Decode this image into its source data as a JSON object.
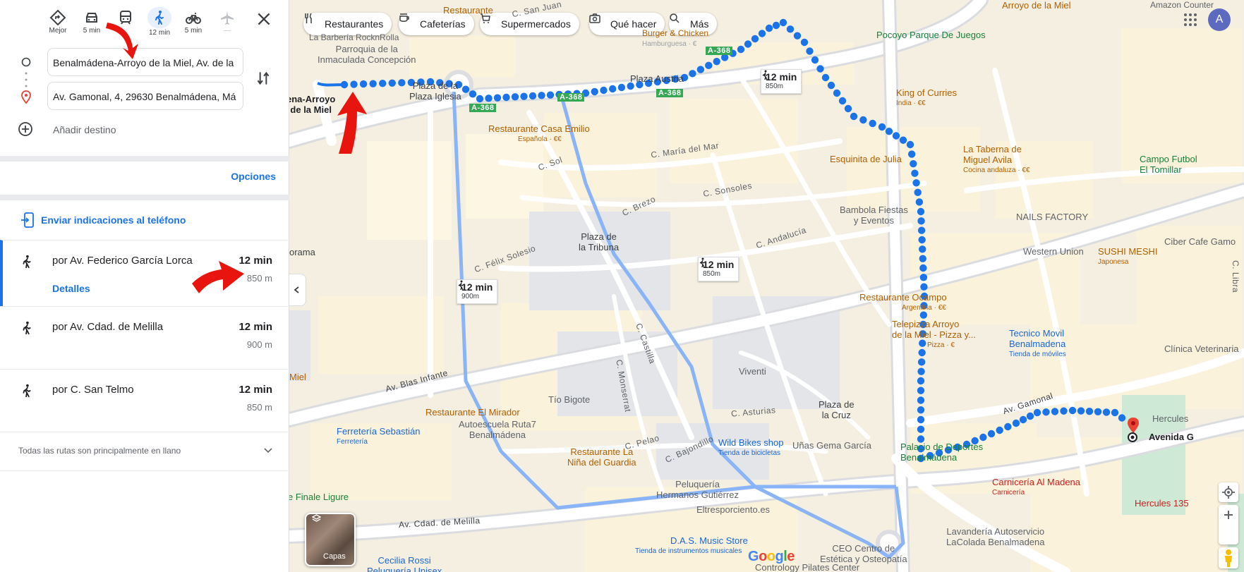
{
  "modes": [
    {
      "label": "Mejor",
      "icon": "diamond-directions-icon"
    },
    {
      "label": "5 min",
      "icon": "car-icon"
    },
    {
      "label": "",
      "icon": "transit-icon"
    },
    {
      "label": "12 min",
      "icon": "walking-icon",
      "active": true
    },
    {
      "label": "5 min",
      "icon": "bicycle-icon"
    },
    {
      "label": "—",
      "icon": "airplane-icon"
    }
  ],
  "origin": "Benalmádena-Arroyo de la Miel, Av. de la",
  "destination": "Av. Gamonal, 4, 29630 Benalmádena, Má",
  "add_destination": "Añadir destino",
  "options": "Opciones",
  "send_to_phone": "Enviar indicaciones al teléfono",
  "routes": [
    {
      "name": "por Av. Federico García Lorca",
      "time": "12 min",
      "distance": "850 m",
      "details": "Detalles"
    },
    {
      "name": "por Av. Cdad. de Melilla",
      "time": "12 min",
      "distance": "900 m"
    },
    {
      "name": "por C. San Telmo",
      "time": "12 min",
      "distance": "850 m"
    }
  ],
  "flat_note": "Todas las rutas son principalmente en llano",
  "chips": [
    {
      "label": "Restaurantes",
      "icon": "fork-knife-icon"
    },
    {
      "label": "Cafeterías",
      "icon": "coffee-icon"
    },
    {
      "label": "Supermercados",
      "icon": "cart-icon"
    },
    {
      "label": "Qué hacer",
      "icon": "camera-icon"
    },
    {
      "label": "Más",
      "icon": "search-icon"
    }
  ],
  "avatar": "A",
  "layers": "Capas",
  "google": "Google",
  "map_labels": {
    "barberia": "La Barbería RocknRolla",
    "parroquia": "Parroquia de la\nInmaculada Concepción",
    "plaza_iglesia": "Plaza de la\nPlaza Iglesia",
    "arroyo": "ena-Arroyo\nde la Miel",
    "burger": "Burger & Chicken",
    "burger_sub": "Hamburguesa · €",
    "pocoyo": "Pocoyo Parque De Juegos",
    "plaza_austria": "Plaza Austria",
    "king_curries": "King of Curries",
    "king_curries_sub": "India · €€",
    "casa_emilio": "Restaurante Casa Emilio",
    "casa_emilio_sub": "Española · €€",
    "esquinita": "Esquinita de Julia",
    "taberna": "La Taberna de\nMiguel Avila",
    "taberna_sub": "Cocina andaluza · €€",
    "campo": "Campo Futbol\nEl Tomillar",
    "bambola": "Bambola Fiestas\ny Eventos",
    "nails": "NAILS FACTORY",
    "ciber": "Ciber Cafe Gamo",
    "western": "Western Union",
    "sushi": "SUSHI MESHI",
    "sushi_sub": "Japonesa",
    "plaza_tribuna": "Plaza de\nla Tribuna",
    "ocampo": "Restaurante Ocampo",
    "ocampo_sub": "Argentina · €€",
    "telepizza": "Telepizza Arroyo\nde la Miel - Pizza y...",
    "telepizza_sub": "Pizza · €",
    "tecnico": "Tecnico Movil\nBenalmadena",
    "tecnico_sub": "Tienda de móviles",
    "clinica": "Clínica Veterinaria",
    "viventi": "Viventi",
    "tio_bigote": "Tío Bigote",
    "mirador": "Restaurante El Mirador",
    "autoescuela": "Autoescuela Ruta7\nBenalmádena",
    "ferreteria": "Ferretería Sebastián",
    "ferreteria_sub": "Ferretería",
    "nina_guardia": "Restaurante La\nNiña del Guardia",
    "wild_bikes": "Wild Bikes shop",
    "wild_bikes_sub": "Tienda de bicicletas",
    "unas": "Uñas Gema García",
    "plaza_cruz": "Plaza de\nla Cruz",
    "palacio": "Palacio de Deportes\nBenalmádena",
    "hercules": "Hercules",
    "avenida_g": "Avenida G",
    "carniceria": "Carnicería Al Madena",
    "carniceria_sub": "Carnicería",
    "hercules135": "Hercules 135",
    "peluqueria": "Peluquería\nHermanos Gutiérrez",
    "eltres": "Eltresporciento.es",
    "das": "D.A.S. Music Store",
    "das_sub": "Tienda de instrumentos musicales",
    "cecilia": "Cecilia Rossi\nPeluquería Unisex",
    "ceo": "CEO Centro de\nEstética y Osteopatía",
    "contrology": "Contrology Pilates Center",
    "lavanderia": "Lavandería Autoservicio\nLaColada Benalmadena",
    "finale": "e Finale Ligure",
    "miel_left": "Miel",
    "orama": "orama",
    "restaurante_top": "Restaurante",
    "arroyo_top": "Arroyo de la Miel",
    "amazon": "Amazon Counter"
  },
  "streets": {
    "san_juan": "C. San Juan",
    "a368a": "A-368",
    "a368b": "A-368",
    "a368c": "A-368",
    "a368d": "A-368",
    "sol": "C. Sol",
    "maria_mar": "C. María del Mar",
    "sonsoles": "C. Sonsoles",
    "brezo": "C. Brezo",
    "andalucia": "C. Andalucía",
    "felix": "C. Félix Solesio",
    "blas": "Av. Blas Infante",
    "monserrat": "C. Monserrat",
    "castilla": "C. Castilla",
    "asturias": "C. Asturias",
    "pelao": "C. Pelao",
    "bajondillo": "C. Bajondillo",
    "melilla": "Av. Cdad. de Melilla",
    "gamonal": "Av. Gamonal",
    "libra": "C. Libra"
  },
  "travel_labels": [
    {
      "time": "12 min",
      "dist": "850m"
    },
    {
      "time": "12 min",
      "dist": "850m"
    },
    {
      "time": "12 min",
      "dist": "900m"
    }
  ],
  "colors": {
    "primary_route": "#1a73e8",
    "alt_route": "#9fb8f2",
    "annotation_red": "#e8150f",
    "accent": "#1a73e8"
  }
}
